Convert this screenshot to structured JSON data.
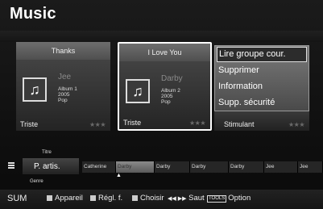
{
  "header": {
    "title": "Music"
  },
  "cards": [
    {
      "song": "Thanks",
      "artist": "Jee",
      "album": "Album 1",
      "year": "2005",
      "genre": "Pop",
      "mood": "Triste",
      "stars": "★★★"
    },
    {
      "song": "I Love You",
      "artist": "Darby",
      "album": "Album 2",
      "year": "2005",
      "genre": "Pop",
      "mood": "Triste",
      "stars": "★★★"
    },
    {
      "mood": "Stimulant",
      "stars": "★★★"
    }
  ],
  "context_menu": {
    "items": [
      "Lire groupe cour.",
      "Supprimer",
      "Information",
      "Supp. sécurité"
    ]
  },
  "sort": {
    "label": "P. artis.",
    "prev_option": "Titre",
    "next_option": "Genre"
  },
  "strip": [
    "Catherine",
    "Darby",
    "Darby",
    "Darby",
    "Darby",
    "Jee",
    "Jee"
  ],
  "footer": {
    "sum": "SUM",
    "appareil": "Appareil",
    "regl": "Régl. f.",
    "choisir": "Choisir",
    "saut_icon": "◀◀ ▶▶",
    "saut": "Saut",
    "tools_icon": "TOOLS",
    "option": "Option"
  },
  "icons": {
    "music_note": "♫"
  }
}
